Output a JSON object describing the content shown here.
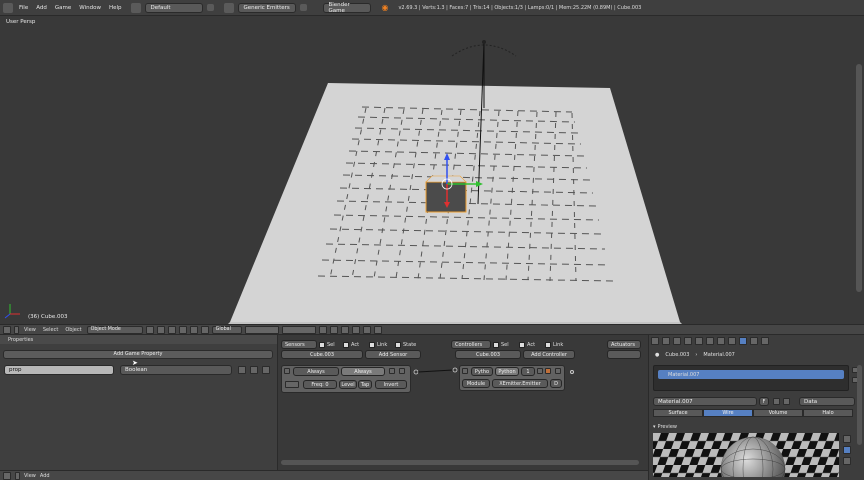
{
  "topbar": {
    "menus": [
      "File",
      "Add",
      "Game",
      "Window",
      "Help"
    ],
    "layout": "Default",
    "scene": "Generic Emitters",
    "engine": "Blender Game",
    "stats": "v2.69.3 | Verts:1.3 | Faces:7 | Tris:14 | Objects:1/3 | Lamps:0/1 | Mem:25.22M (0.89M) | Cube.003"
  },
  "viewport": {
    "label": "User Persp",
    "object_label": "(36) Cube.003"
  },
  "vpheader": {
    "menus": [
      "View",
      "Select",
      "Object"
    ],
    "mode": "Object Mode",
    "orientation": "Global"
  },
  "properties_panel": {
    "title": "Properties",
    "add_button": "Add Game Property",
    "prop_name": "prop",
    "prop_type": "Boolean"
  },
  "logic": {
    "sensors": {
      "header": "Sensors",
      "filters": [
        "Sel",
        "Act",
        "Link",
        "State"
      ],
      "object": "Cube.003",
      "add": "Add Sensor",
      "brick_type": "Always",
      "brick_name": "Always",
      "freq_label": "Freq: 0",
      "level": "Level",
      "tap": "Tap",
      "invert": "Invert"
    },
    "controllers": {
      "header": "Controllers",
      "filters": [
        "Sel",
        "Act",
        "Link"
      ],
      "object": "Cube.003",
      "add": "Add Controller",
      "brick_type": "Pytho",
      "brick_name": "Python",
      "brick_num": "1",
      "mode": "Module",
      "module": "XEmitter.Emitter",
      "d": "D"
    },
    "actuators": {
      "header": "Actuators"
    }
  },
  "rpanel": {
    "breadcrumb_obj": "Cube.003",
    "breadcrumb_mat": "Material.007",
    "slot": "Material.007",
    "material_field": "Material.007",
    "f_label": "F",
    "data": "Data",
    "tabs": [
      "Surface",
      "Wire",
      "Volume",
      "Halo"
    ],
    "active_tab": "Wire",
    "preview": "Preview"
  },
  "bottom": {
    "menus": [
      "View",
      "Add"
    ]
  },
  "colors": {
    "accent": "#5680c2",
    "selection_outline": "#f0a030"
  }
}
